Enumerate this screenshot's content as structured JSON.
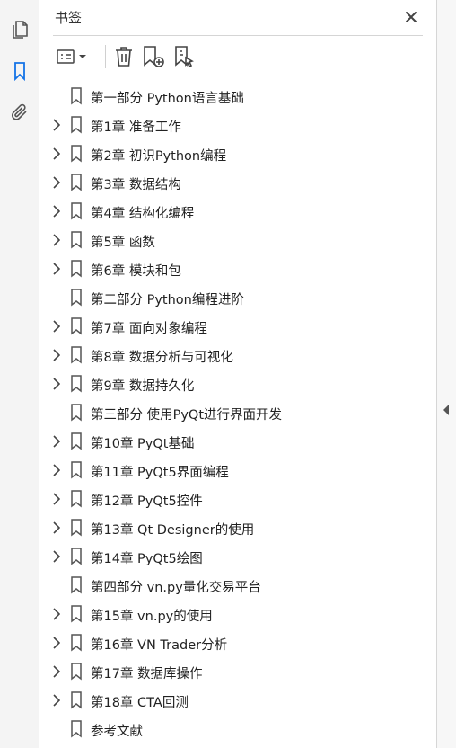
{
  "panel": {
    "title": "书签"
  },
  "rail": {
    "items": [
      {
        "name": "pages-icon",
        "active": false
      },
      {
        "name": "bookmark-icon",
        "active": true
      },
      {
        "name": "attachment-icon",
        "active": false
      }
    ]
  },
  "toolbar": {
    "icons": [
      "options-menu-icon",
      "chevron-down-icon",
      "delete-icon",
      "new-bookmark-icon",
      "bookmark-from-selection-icon"
    ]
  },
  "colors": {
    "accent": "#1473e6",
    "icon": "#555555",
    "text": "#222222",
    "rail_bg": "#f4f4f4"
  },
  "bookmarks": [
    {
      "label": "第一部分 Python语言基础",
      "expandable": false
    },
    {
      "label": "第1章 准备工作",
      "expandable": true
    },
    {
      "label": "第2章 初识Python编程",
      "expandable": true
    },
    {
      "label": "第3章 数据结构",
      "expandable": true
    },
    {
      "label": "第4章 结构化编程",
      "expandable": true
    },
    {
      "label": "第5章 函数",
      "expandable": true
    },
    {
      "label": "第6章 模块和包",
      "expandable": true
    },
    {
      "label": "第二部分 Python编程进阶",
      "expandable": false
    },
    {
      "label": "第7章 面向对象编程",
      "expandable": true
    },
    {
      "label": "第8章 数据分析与可视化",
      "expandable": true
    },
    {
      "label": "第9章 数据持久化",
      "expandable": true
    },
    {
      "label": "第三部分 使用PyQt进行界面开发",
      "expandable": false
    },
    {
      "label": "第10章 PyQt基础",
      "expandable": true
    },
    {
      "label": "第11章 PyQt5界面编程",
      "expandable": true
    },
    {
      "label": "第12章 PyQt5控件",
      "expandable": true
    },
    {
      "label": "第13章 Qt Designer的使用",
      "expandable": true
    },
    {
      "label": "第14章 PyQt5绘图",
      "expandable": true
    },
    {
      "label": "第四部分 vn.py量化交易平台",
      "expandable": false
    },
    {
      "label": "第15章 vn.py的使用",
      "expandable": true
    },
    {
      "label": "第16章 VN Trader分析",
      "expandable": true
    },
    {
      "label": "第17章 数据库操作",
      "expandable": true
    },
    {
      "label": "第18章 CTA回测",
      "expandable": true
    },
    {
      "label": "参考文献",
      "expandable": false
    }
  ]
}
